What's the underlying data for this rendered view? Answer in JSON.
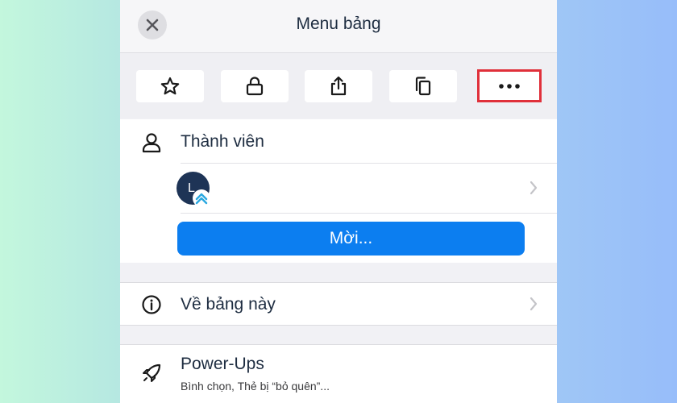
{
  "header": {
    "title": "Menu bảng",
    "close_icon": "close-icon"
  },
  "toolbar": {
    "buttons": [
      "star-icon",
      "lock-icon",
      "share-icon",
      "copy-icon",
      "more-icon"
    ],
    "highlight_color": "#e0303a"
  },
  "members": {
    "label": "Thành viên",
    "avatar_initial": "L",
    "invite_label": "Mời..."
  },
  "about": {
    "label": "Về bảng này"
  },
  "power_ups": {
    "label": "Power-Ups",
    "subtitle": "Bình chọn, Thẻ bị “bỏ quên”..."
  },
  "colors": {
    "accent": "#0c7ef0",
    "text": "#1d2c40",
    "avatar_bg": "#1e3456",
    "badge": "#2aa8e0"
  }
}
